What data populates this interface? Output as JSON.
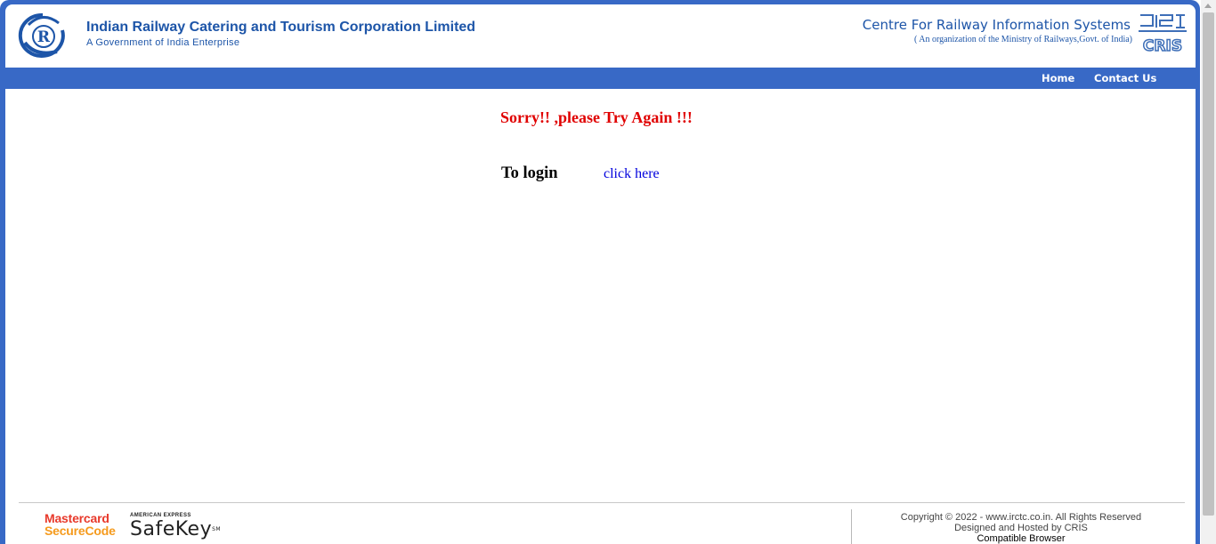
{
  "header": {
    "title": "Indian Railway Catering and Tourism Corporation Limited",
    "subtitle": "A Government of India Enterprise",
    "cris_title": "Centre For Railway Information Systems",
    "cris_subtitle": "( An organization of the Ministry of Railways,Govt. of India)",
    "cris_logo_text": "CRIS",
    "irctc_logo_letter": "R"
  },
  "nav": {
    "items": [
      {
        "label": "Home"
      },
      {
        "label": "Contact Us"
      }
    ]
  },
  "main": {
    "error_message": "Sorry!! ,please Try Again !!!",
    "login_label": "To login",
    "login_link": "click here"
  },
  "footer": {
    "mastercard_line1": "Mastercard",
    "mastercard_line2": "SecureCode",
    "amex_small": "AMERICAN EXPRESS",
    "amex_big": "SafeKey",
    "amex_tm": "SM",
    "copyright": "Copyright © 2022 - www.irctc.co.in. All Rights Reserved",
    "designed_by": "Designed and Hosted by CRIS",
    "compatible": "Compatible Browser"
  },
  "colors": {
    "brand_blue": "#3869c6",
    "header_text": "#1d55a8",
    "error_red": "#e00000",
    "link_blue": "#0000dd"
  }
}
